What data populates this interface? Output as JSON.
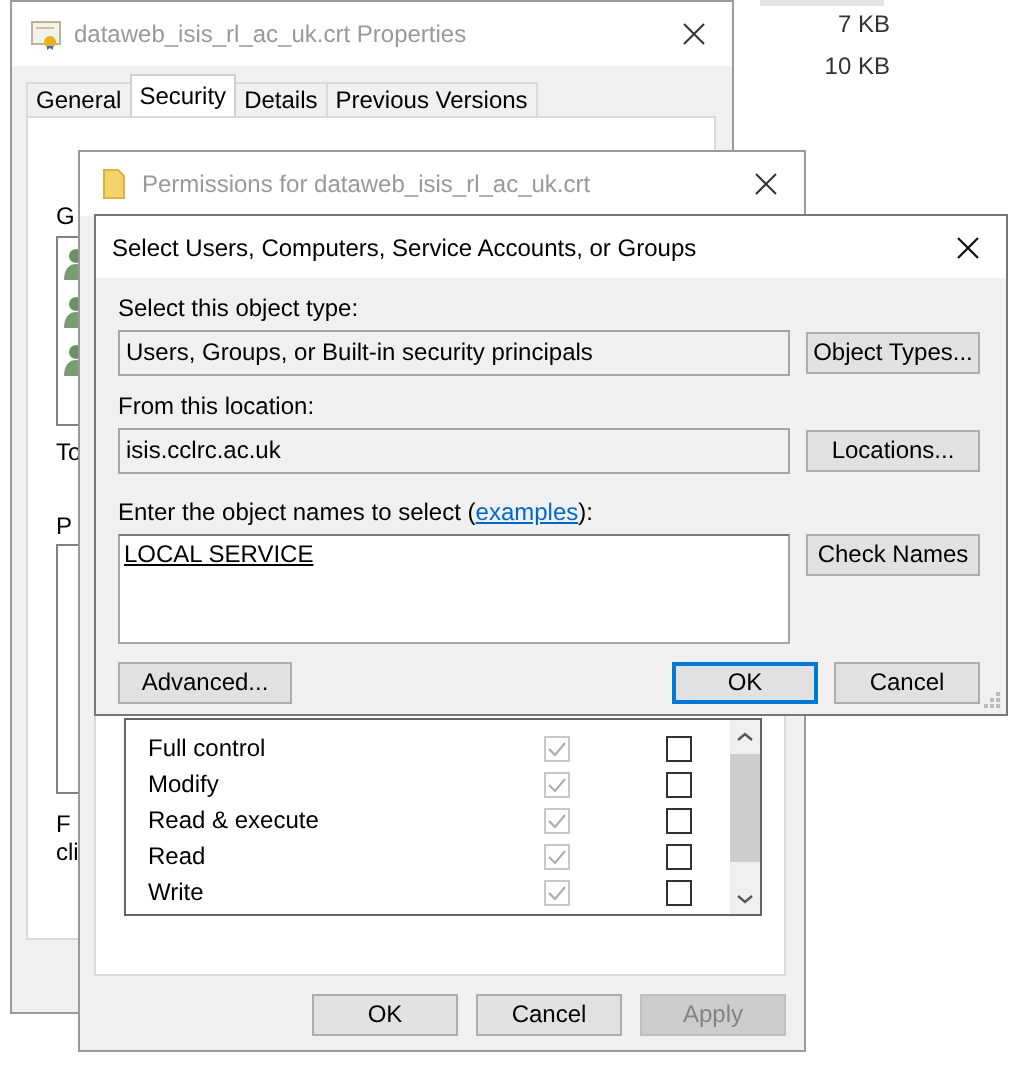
{
  "background": {
    "sizes": [
      "7 KB",
      "10 KB"
    ]
  },
  "properties_window": {
    "title": "dataweb_isis_rl_ac_uk.crt Properties",
    "tabs": [
      {
        "label": "General",
        "selected": false
      },
      {
        "label": "Security",
        "selected": true
      },
      {
        "label": "Details",
        "selected": false
      },
      {
        "label": "Previous Versions",
        "selected": false
      }
    ],
    "fragments": [
      "G",
      "To",
      "P",
      "F",
      "cli"
    ]
  },
  "permissions_window": {
    "title": "Permissions for dataweb_isis_rl_ac_uk.crt",
    "permissions": [
      {
        "name": "Full control",
        "allow": true,
        "allow_inherited": true,
        "deny": false
      },
      {
        "name": "Modify",
        "allow": true,
        "allow_inherited": true,
        "deny": false
      },
      {
        "name": "Read & execute",
        "allow": true,
        "allow_inherited": true,
        "deny": false
      },
      {
        "name": "Read",
        "allow": true,
        "allow_inherited": true,
        "deny": false
      },
      {
        "name": "Write",
        "allow": true,
        "allow_inherited": true,
        "deny": false
      }
    ],
    "buttons": [
      {
        "label": "OK",
        "disabled": false
      },
      {
        "label": "Cancel",
        "disabled": false
      },
      {
        "label": "Apply",
        "disabled": true
      }
    ]
  },
  "select_dialog": {
    "title": "Select Users, Computers, Service Accounts, or Groups",
    "object_type_label": "Select this object type:",
    "object_type": "Users, Groups, or Built-in security principals",
    "object_type_button": "Object Types...",
    "location_label": "From this location:",
    "location": "isis.cclrc.ac.uk",
    "location_button": "Locations...",
    "names_label": "Enter the object names to select (",
    "names_link": "examples",
    "names_label_end": "):",
    "names_value": "LOCAL SERVICE",
    "check_button": "Check Names",
    "buttons": [
      {
        "label": "Advanced...",
        "default": false
      },
      {
        "label": "OK",
        "default": true
      },
      {
        "label": "Cancel",
        "default": false
      }
    ]
  }
}
